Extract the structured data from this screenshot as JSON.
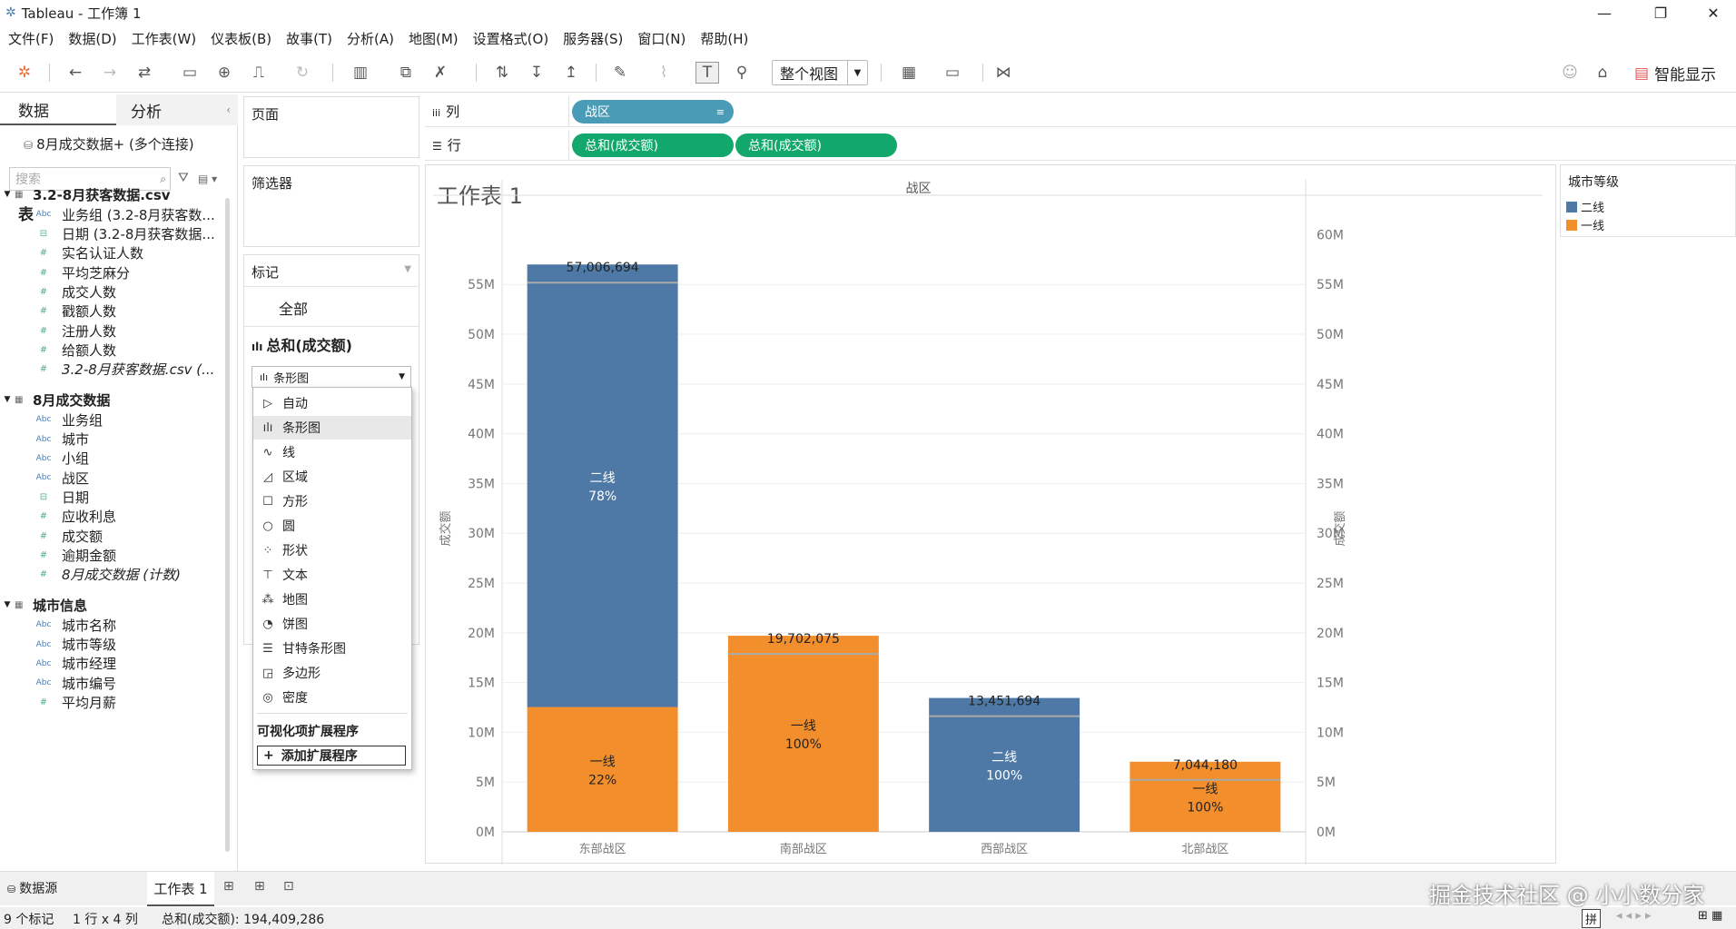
{
  "window": {
    "app_title": "Tableau - 工作簿 1"
  },
  "menu": [
    "文件(F)",
    "数据(D)",
    "工作表(W)",
    "仪表板(B)",
    "故事(T)",
    "分析(A)",
    "地图(M)",
    "设置格式(O)",
    "服务器(S)",
    "窗口(N)",
    "帮助(H)"
  ],
  "toolbar": {
    "fit_label": "整个视图",
    "smart_label": "智能显示"
  },
  "left": {
    "tab_data": "数据",
    "tab_analysis": "分析",
    "datasource": "8月成交数据+ (多个连接)",
    "search_placeholder": "搜索",
    "tables_label": "表",
    "groups": [
      {
        "name": "3.2-8月获客数据.csv",
        "fields": [
          {
            "type": "abc",
            "name": "业务组 (3.2-8月获客数..."
          },
          {
            "type": "date",
            "name": "日期 (3.2-8月获客数据..."
          },
          {
            "type": "num",
            "name": "实名认证人数"
          },
          {
            "type": "num",
            "name": "平均芝麻分"
          },
          {
            "type": "num",
            "name": "成交人数"
          },
          {
            "type": "num",
            "name": "戳额人数"
          },
          {
            "type": "num",
            "name": "注册人数"
          },
          {
            "type": "num",
            "name": "给额人数"
          },
          {
            "type": "num",
            "name": "3.2-8月获客数据.csv (..."
          }
        ]
      },
      {
        "name": "8月成交数据",
        "fields": [
          {
            "type": "abc",
            "name": "业务组"
          },
          {
            "type": "abc",
            "name": "城市"
          },
          {
            "type": "abc",
            "name": "小组"
          },
          {
            "type": "abc",
            "name": "战区"
          },
          {
            "type": "date",
            "name": "日期"
          },
          {
            "type": "num",
            "name": "应收利息"
          },
          {
            "type": "num",
            "name": "成交额"
          },
          {
            "type": "num",
            "name": "逾期金额"
          },
          {
            "type": "num",
            "name": "8月成交数据 (计数)"
          }
        ]
      },
      {
        "name": "城市信息",
        "fields": [
          {
            "type": "abc",
            "name": "城市名称"
          },
          {
            "type": "abc",
            "name": "城市等级"
          },
          {
            "type": "abc",
            "name": "城市经理"
          },
          {
            "type": "abc",
            "name": "城市编号"
          },
          {
            "type": "num",
            "name": "平均月薪"
          }
        ]
      }
    ]
  },
  "cards": {
    "pages": "页面",
    "filters": "筛选器",
    "marks": "标记",
    "marks_all": "全部",
    "marks_measure": "总和(成交额)",
    "marktype_selected": "条形图"
  },
  "mark_types": [
    "自动",
    "条形图",
    "线",
    "区域",
    "方形",
    "圆",
    "形状",
    "文本",
    "地图",
    "饼图",
    "甘特条形图",
    "多边形",
    "密度"
  ],
  "mark_type_icons": [
    "play-outline",
    "bar",
    "line",
    "area",
    "square",
    "circle",
    "shapes",
    "text",
    "map",
    "pie",
    "gantt",
    "polygon",
    "density"
  ],
  "extensions": {
    "heading": "可视化项扩展程序",
    "add": "添加扩展程序"
  },
  "shelves": {
    "columns_label": "列",
    "rows_label": "行",
    "col_pill": "战区",
    "row_pills": [
      "总和(成交额)",
      "总和(成交额)"
    ]
  },
  "sheet": {
    "title": "工作表 1"
  },
  "legend": {
    "title": "城市等级",
    "items": [
      {
        "label": "二线",
        "color": "#4e79a7"
      },
      {
        "label": "一线",
        "color": "#f28e2b"
      }
    ]
  },
  "chart_data": {
    "type": "bar",
    "stacked": true,
    "header": "战区",
    "categories": [
      "东部战区",
      "南部战区",
      "西部战区",
      "北部战区"
    ],
    "series": [
      {
        "name": "二线",
        "color": "#4e79a7",
        "values": [
          44465221,
          0,
          13451694,
          0
        ],
        "labels": [
          "二线\n78%",
          "",
          "二线\n100%",
          ""
        ]
      },
      {
        "name": "一线",
        "color": "#f28e2b",
        "values": [
          12541473,
          19702075,
          0,
          7044180
        ],
        "labels": [
          "一线\n22%",
          "一线\n100%",
          "",
          "一线\n100%"
        ]
      }
    ],
    "totals": [
      "57,006,694",
      "19,702,075",
      "13,451,694",
      "7,044,180"
    ],
    "ylabel": "成交额",
    "left_ticks": [
      "0M",
      "5M",
      "10M",
      "15M",
      "20M",
      "25M",
      "30M",
      "35M",
      "40M",
      "45M",
      "50M",
      "55M"
    ],
    "right_ticks": [
      "0M",
      "5M",
      "10M",
      "15M",
      "20M",
      "25M",
      "30M",
      "35M",
      "40M",
      "45M",
      "50M",
      "55M",
      "60M"
    ],
    "ylim": [
      0,
      61500000
    ]
  },
  "tabs": {
    "datasource": "数据源",
    "sheet1": "工作表 1"
  },
  "status": {
    "marks": "9 个标记",
    "dims": "1 行 x 4 列",
    "sum": "总和(成交额): 194,409,286"
  },
  "watermark": "掘金技术社区 @ 小小数分家"
}
